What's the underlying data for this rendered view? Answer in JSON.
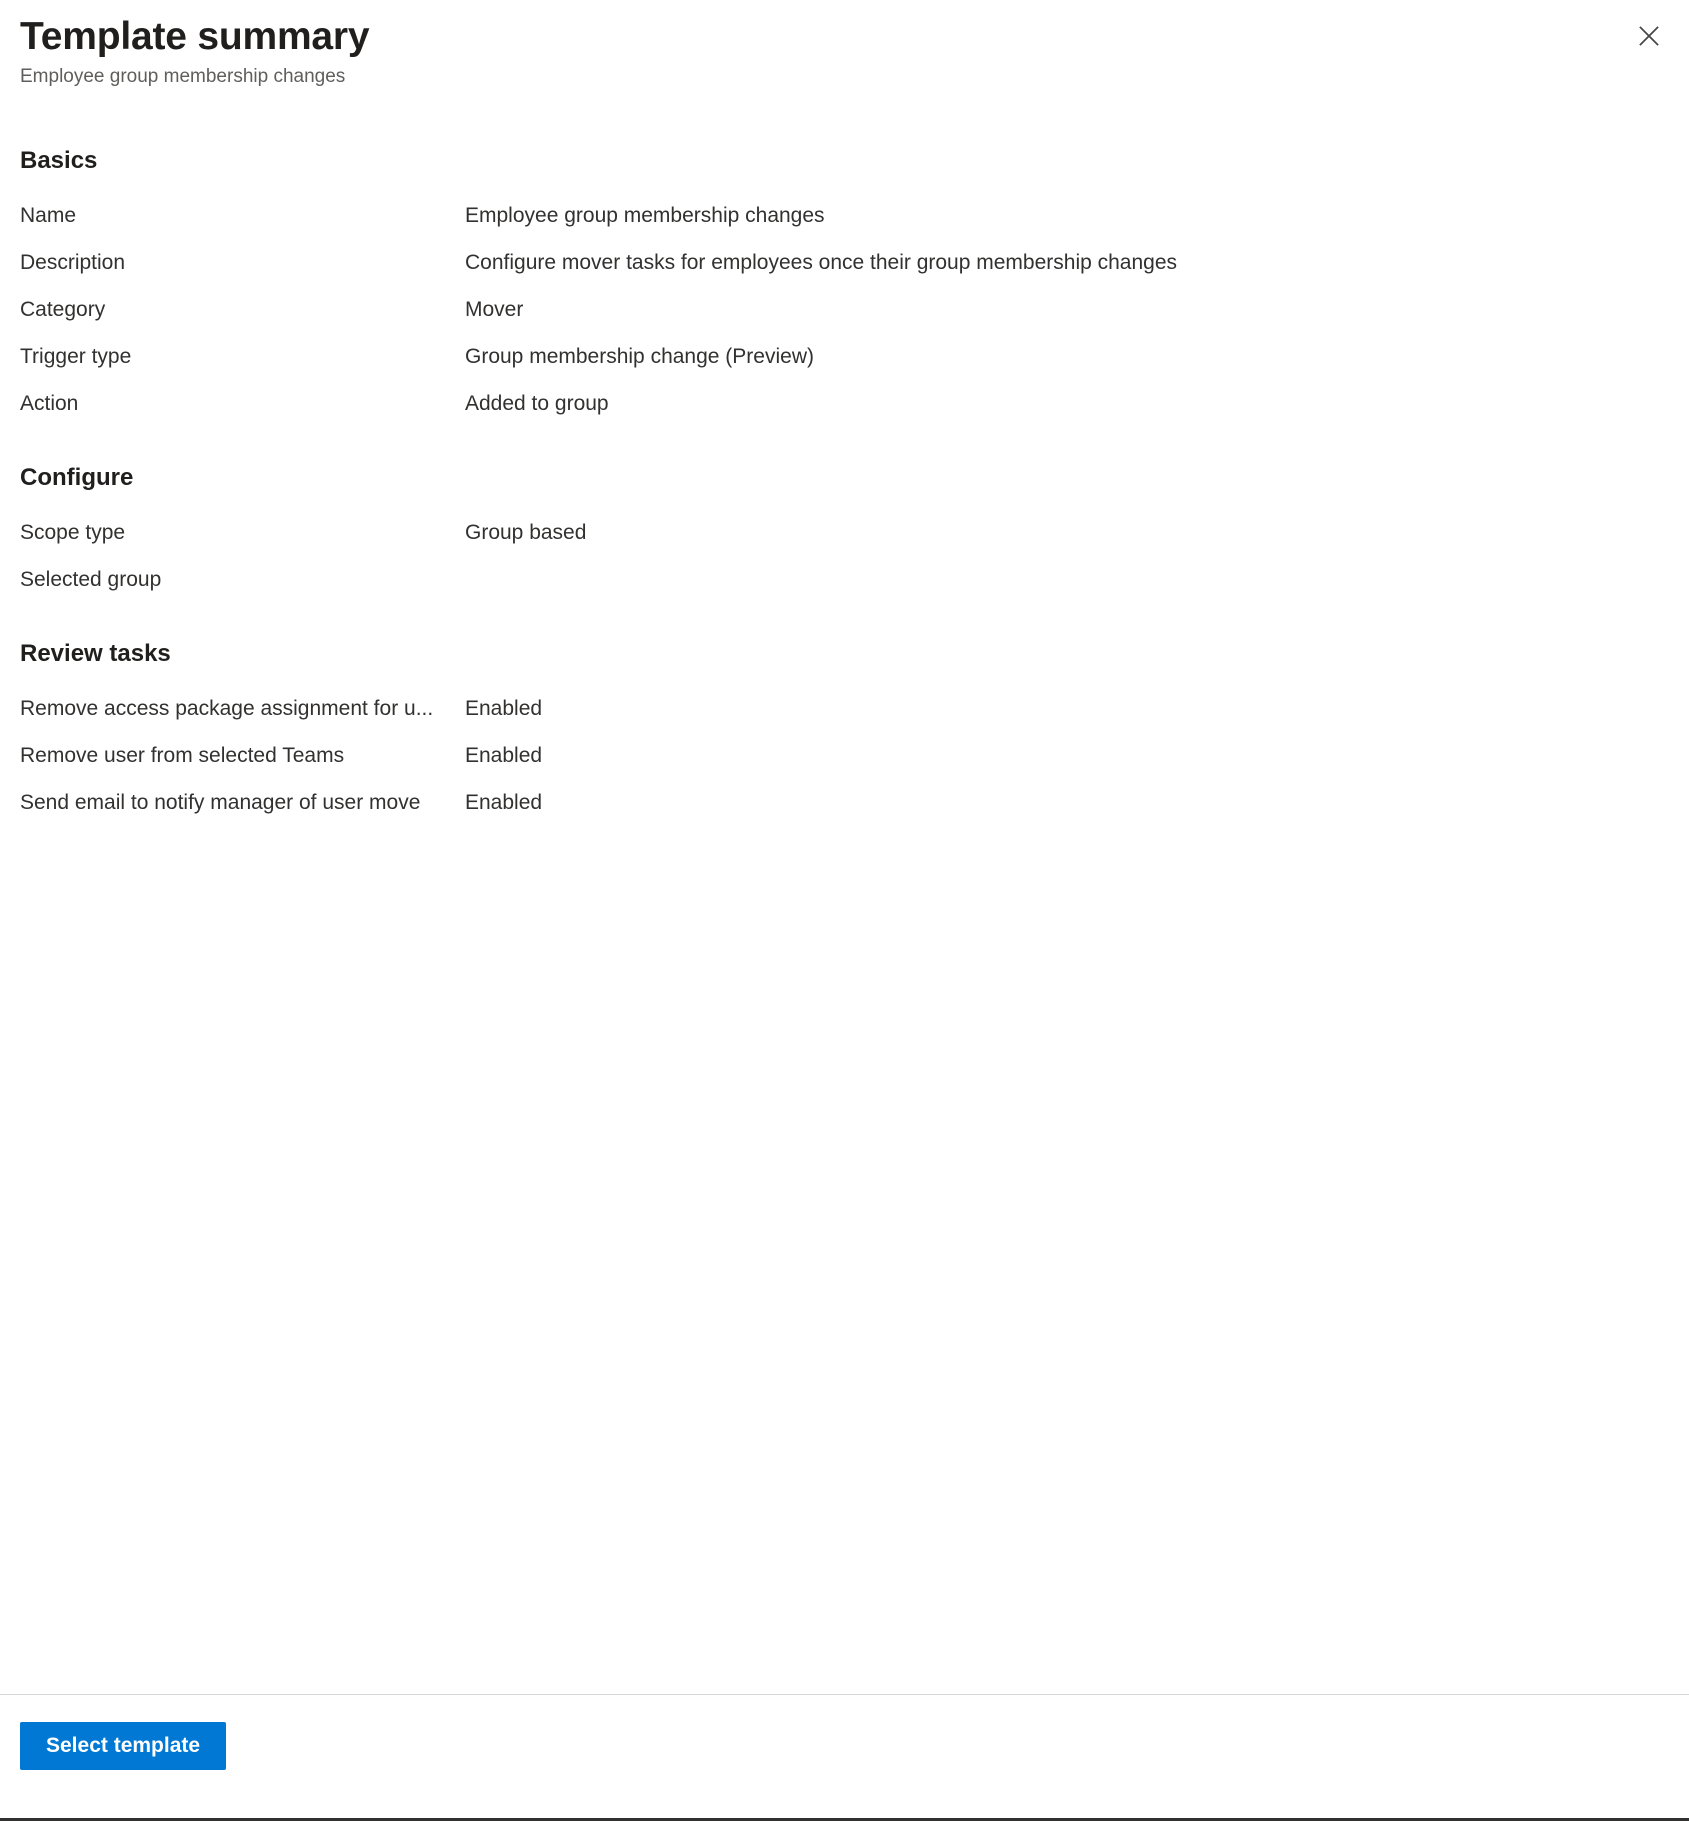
{
  "header": {
    "title": "Template summary",
    "subtitle": "Employee group membership changes",
    "close_icon": "close-icon",
    "close_label": "Close"
  },
  "sections": [
    {
      "id": "basics",
      "heading": "Basics",
      "rows": [
        {
          "key": "Name",
          "value": "Employee group membership changes"
        },
        {
          "key": "Description",
          "value": "Configure mover tasks for employees once their group membership changes"
        },
        {
          "key": "Category",
          "value": "Mover"
        },
        {
          "key": "Trigger type",
          "value": "Group membership change (Preview)"
        },
        {
          "key": "Action",
          "value": "Added to group"
        }
      ]
    },
    {
      "id": "configure",
      "heading": "Configure",
      "rows": [
        {
          "key": "Scope type",
          "value": "Group based"
        },
        {
          "key": "Selected group",
          "value": ""
        }
      ]
    },
    {
      "id": "review-tasks",
      "heading": "Review tasks",
      "rows": [
        {
          "key": "Remove access package assignment for u...",
          "value": "Enabled"
        },
        {
          "key": "Remove user from selected Teams",
          "value": "Enabled"
        },
        {
          "key": "Send email to notify manager of user move",
          "value": "Enabled"
        }
      ]
    }
  ],
  "footer": {
    "primary_button_label": "Select template"
  },
  "colors": {
    "accent": "#0078d4",
    "text": "#323130",
    "title": "#201f1e",
    "subtitle": "#605e5c",
    "divider": "#d6d6d6"
  }
}
